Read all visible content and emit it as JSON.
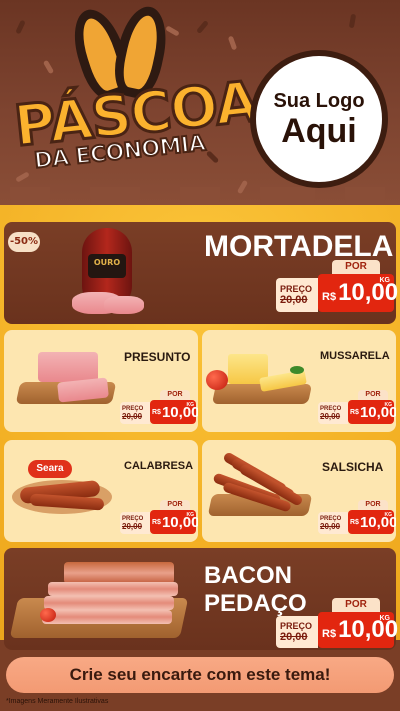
{
  "header": {
    "title_main": "PÁSCOA",
    "title_sub": "DA ECONOMIA",
    "logo_line1": "Sua Logo",
    "logo_line2": "Aqui"
  },
  "featured": [
    {
      "name": "MORTADELA",
      "brand": "OURO",
      "discount_badge": "-50%",
      "old_label": "PREÇO",
      "old_price": "20,00",
      "por_label": "POR",
      "currency": "R$",
      "new_price": "10,00",
      "unit": "KG"
    },
    {
      "name": "BACON PEDAÇO",
      "old_label": "PREÇO",
      "old_price": "20,00",
      "por_label": "POR",
      "currency": "R$",
      "new_price": "10,00",
      "unit": "KG"
    }
  ],
  "products": [
    {
      "name": "PRESUNTO",
      "old_label": "PREÇO",
      "old_price": "20,00",
      "por_label": "POR",
      "currency": "R$",
      "new_price": "10,00",
      "unit": "KG"
    },
    {
      "name": "MUSSARELA",
      "old_label": "PREÇO",
      "old_price": "20,00",
      "por_label": "POR",
      "currency": "R$",
      "new_price": "10,00",
      "unit": "KG"
    },
    {
      "name": "CALABRESA",
      "brand": "Seara",
      "old_label": "PREÇO",
      "old_price": "20,00",
      "por_label": "POR",
      "currency": "R$",
      "new_price": "10,00",
      "unit": "KG"
    },
    {
      "name": "SALSICHA",
      "old_label": "PREÇO",
      "old_price": "20,00",
      "por_label": "POR",
      "currency": "R$",
      "new_price": "10,00",
      "unit": "KG"
    }
  ],
  "cta": "Crie seu encarte com este tema!",
  "disclaimer": "*Imagens Meramente Ilustrativas",
  "colors": {
    "chocolate": "#7a3e26",
    "accent_red": "#e2260f",
    "yellow_bg": "#f3b52a",
    "cream_card": "#fde6b0"
  }
}
